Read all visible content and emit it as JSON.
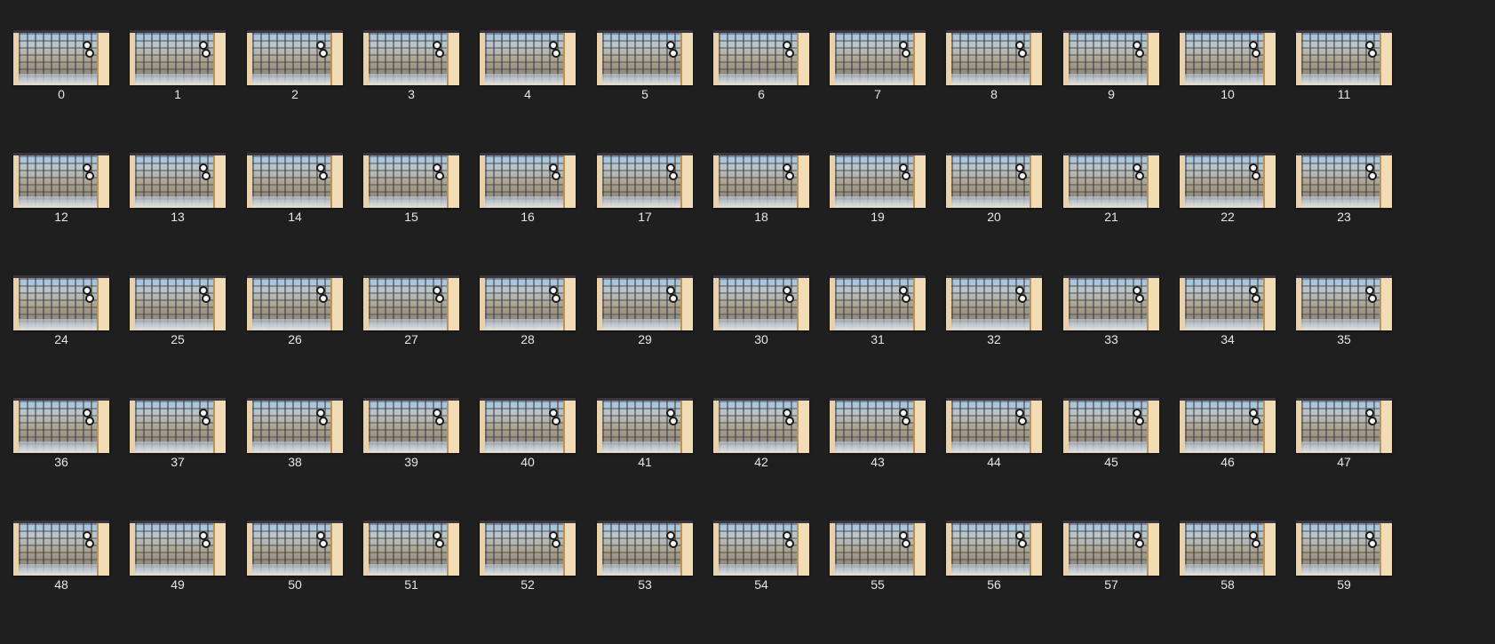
{
  "window": {
    "background": "#1f1f1f"
  },
  "items": [
    {
      "label": "0"
    },
    {
      "label": "1"
    },
    {
      "label": "2"
    },
    {
      "label": "3"
    },
    {
      "label": "4"
    },
    {
      "label": "5"
    },
    {
      "label": "6"
    },
    {
      "label": "7"
    },
    {
      "label": "8"
    },
    {
      "label": "9"
    },
    {
      "label": "10"
    },
    {
      "label": "11"
    },
    {
      "label": "12"
    },
    {
      "label": "13"
    },
    {
      "label": "14"
    },
    {
      "label": "15"
    },
    {
      "label": "16"
    },
    {
      "label": "17"
    },
    {
      "label": "18"
    },
    {
      "label": "19"
    },
    {
      "label": "20"
    },
    {
      "label": "21"
    },
    {
      "label": "22"
    },
    {
      "label": "23"
    },
    {
      "label": "24"
    },
    {
      "label": "25"
    },
    {
      "label": "26"
    },
    {
      "label": "27"
    },
    {
      "label": "28"
    },
    {
      "label": "29"
    },
    {
      "label": "30"
    },
    {
      "label": "31"
    },
    {
      "label": "32"
    },
    {
      "label": "33"
    },
    {
      "label": "34"
    },
    {
      "label": "35"
    },
    {
      "label": "36"
    },
    {
      "label": "37"
    },
    {
      "label": "38"
    },
    {
      "label": "39"
    },
    {
      "label": "40"
    },
    {
      "label": "41"
    },
    {
      "label": "42"
    },
    {
      "label": "43"
    },
    {
      "label": "44"
    },
    {
      "label": "45"
    },
    {
      "label": "46"
    },
    {
      "label": "47"
    },
    {
      "label": "48"
    },
    {
      "label": "49"
    },
    {
      "label": "50"
    },
    {
      "label": "51"
    },
    {
      "label": "52"
    },
    {
      "label": "53"
    },
    {
      "label": "54"
    },
    {
      "label": "55"
    },
    {
      "label": "56"
    },
    {
      "label": "57"
    },
    {
      "label": "58"
    },
    {
      "label": "59"
    }
  ]
}
